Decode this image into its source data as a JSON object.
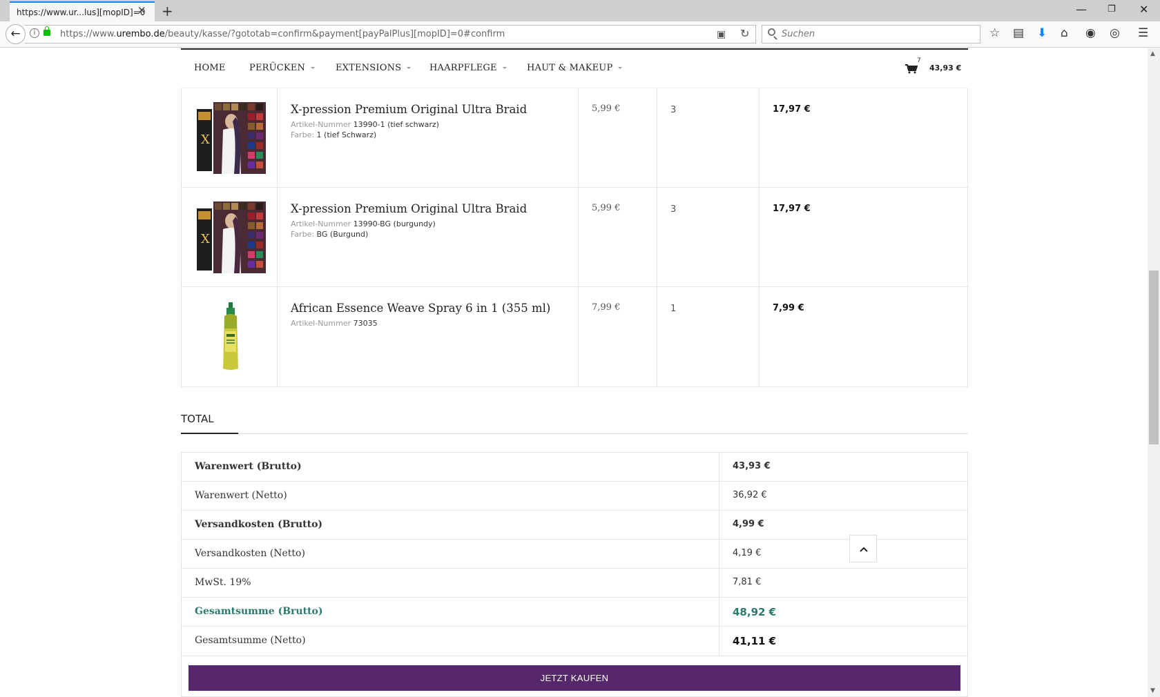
{
  "browser": {
    "tab_title": "https://www.ur...lus][mopID]=0",
    "tab_close": "✕",
    "new_tab": "+",
    "url_prefix": "https://www.",
    "url_domain": "urembo.de",
    "url_path": "/beauty/kasse/?gototab=confirm&payment[payPalPlus][mopID]=0#confirm",
    "search_placeholder": "Suchen"
  },
  "menu": {
    "items": [
      {
        "label": "HOME",
        "dropdown": false
      },
      {
        "label": "PERÜCKEN",
        "dropdown": true
      },
      {
        "label": "EXTENSIONS",
        "dropdown": true
      },
      {
        "label": "HAARPFLEGE",
        "dropdown": true
      },
      {
        "label": "HAUT & MAKEUP",
        "dropdown": true
      }
    ],
    "cart_count": "7",
    "cart_total": "43,93 €"
  },
  "products": [
    {
      "name": "X-pression Premium Original Ultra Braid",
      "meta": [
        {
          "key": "Artikel-Nummer",
          "value": "13990-1 (tief schwarz)"
        },
        {
          "key": "Farbe:",
          "value": "1 (tief Schwarz)"
        }
      ],
      "price": "5,99 €",
      "qty": "3",
      "sum": "17,97 €",
      "hair_color": "#3b2a4a"
    },
    {
      "name": "X-pression Premium Original Ultra Braid",
      "meta": [
        {
          "key": "Artikel-Nummer",
          "value": "13990-BG (burgundy)"
        },
        {
          "key": "Farbe:",
          "value": "BG (Burgund)"
        }
      ],
      "price": "5,99 €",
      "qty": "3",
      "sum": "17,97 €",
      "hair_color": "#4a2740"
    },
    {
      "name": "African Essence Weave Spray 6 in 1 (355 ml)",
      "meta": [
        {
          "key": "Artikel-Nummer",
          "value": "73035"
        }
      ],
      "price": "7,99 €",
      "qty": "1",
      "sum": "7,99 €"
    }
  ],
  "totals": {
    "heading": "TOTAL",
    "rows": [
      {
        "label": "Warenwert (Brutto)",
        "value": "43,93 €",
        "style": "bold"
      },
      {
        "label": "Warenwert (Netto)",
        "value": "36,92 €",
        "style": "normal"
      },
      {
        "label": "Versandkosten (Brutto)",
        "value": "4,99 €",
        "style": "bold"
      },
      {
        "label": "Versandkosten (Netto)",
        "value": "4,19 €",
        "style": "normal"
      },
      {
        "label": "MwSt. 19%",
        "value": "7,81 €",
        "style": "normal"
      },
      {
        "label": "Gesamtsumme (Brutto)",
        "value": "48,92 €",
        "style": "green"
      },
      {
        "label": "Gesamtsumme (Netto)",
        "value": "41,11 €",
        "style": "big"
      }
    ]
  },
  "buy_button": "JETZT KAUFEN",
  "colors": {
    "accent_purple": "#56286b",
    "total_green": "#2a7a6e",
    "lock_green": "#12bc00"
  },
  "icons": [
    "back-arrow-icon",
    "info-icon",
    "lock-icon",
    "reader-view-icon",
    "reload-icon",
    "search-icon",
    "bookmark-star-icon",
    "library-icon",
    "download-icon",
    "home-icon",
    "pocket-icon",
    "sync-icon",
    "hamburger-menu-icon",
    "cart-icon",
    "chevron-up-icon"
  ]
}
